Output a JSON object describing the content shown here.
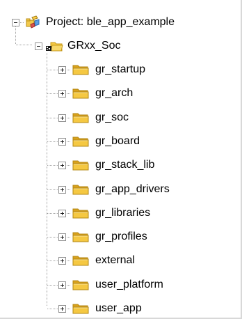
{
  "tree": {
    "project": {
      "label": "Project: ble_app_example",
      "icon": "project-icon",
      "expanded": true
    },
    "target": {
      "label": "GRxx_Soc",
      "icon": "target-folder-icon",
      "expanded": true
    },
    "groups": [
      {
        "label": "gr_startup",
        "icon": "folder-icon",
        "expanded": false
      },
      {
        "label": "gr_arch",
        "icon": "folder-icon",
        "expanded": false
      },
      {
        "label": "gr_soc",
        "icon": "folder-icon",
        "expanded": false
      },
      {
        "label": "gr_board",
        "icon": "folder-icon",
        "expanded": false
      },
      {
        "label": "gr_stack_lib",
        "icon": "folder-icon",
        "expanded": false
      },
      {
        "label": "gr_app_drivers",
        "icon": "folder-icon",
        "expanded": false
      },
      {
        "label": "gr_libraries",
        "icon": "folder-icon",
        "expanded": false
      },
      {
        "label": "gr_profiles",
        "icon": "folder-icon",
        "expanded": false
      },
      {
        "label": "external",
        "icon": "folder-icon",
        "expanded": false
      },
      {
        "label": "user_platform",
        "icon": "folder-icon",
        "expanded": false
      },
      {
        "label": "user_app",
        "icon": "folder-icon",
        "expanded": false
      }
    ]
  },
  "colors": {
    "folder_fill": "#f5c842",
    "folder_shade": "#d9a21c",
    "tree_line": "#a0a0a0",
    "expander_border": "#919191"
  }
}
